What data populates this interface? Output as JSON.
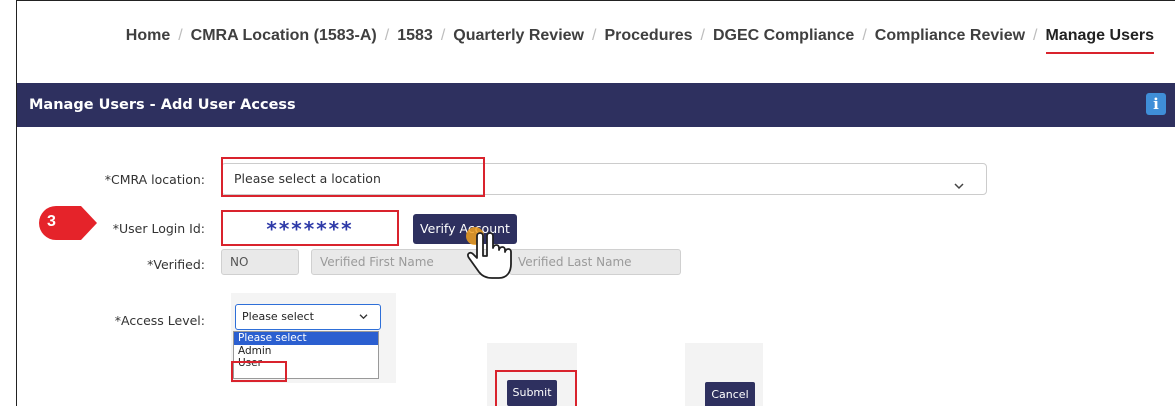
{
  "breadcrumb": [
    {
      "label": "Home"
    },
    {
      "label": "CMRA Location (1583-A)"
    },
    {
      "label": "1583"
    },
    {
      "label": "Quarterly Review"
    },
    {
      "label": "Procedures"
    },
    {
      "label": "DGEC Compliance"
    },
    {
      "label": "Compliance Review"
    },
    {
      "label": "Manage Users",
      "active": true
    }
  ],
  "header": {
    "title": "Manage Users - Add User Access",
    "info_icon": "info-icon"
  },
  "form": {
    "location_label": "*CMRA location:",
    "location_value": "Please select a location",
    "login_label": "*User Login Id:",
    "login_value": "*******",
    "verify_button": "Verify Account",
    "verified_label": "*Verified:",
    "verified_value": "NO",
    "first_name_placeholder": "Verified First Name",
    "last_name_placeholder": "Verified Last Name",
    "access_label": "*Access Level:",
    "access_selected": "Please select",
    "access_options": [
      "Please select",
      "Admin",
      "User"
    ],
    "submit_button": "Submit",
    "cancel_button": "Cancel"
  },
  "step_badge": "3",
  "colors": {
    "header_bg": "#2e305f",
    "highlight": "#d9232d",
    "active_underline": "#d9232d",
    "badge": "#e5232a"
  }
}
